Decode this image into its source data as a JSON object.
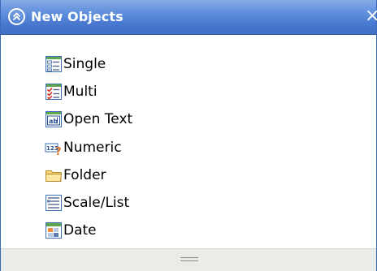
{
  "panel": {
    "title": "New Objects",
    "close_glyph": "×",
    "collapse_icon": "double-chevron-up-icon"
  },
  "items": [
    {
      "label": "Single",
      "icon": "single-choice-icon"
    },
    {
      "label": "Multi",
      "icon": "multi-choice-icon"
    },
    {
      "label": "Open Text",
      "icon": "open-text-icon"
    },
    {
      "label": "Numeric",
      "icon": "numeric-icon"
    },
    {
      "label": "Folder",
      "icon": "folder-icon"
    },
    {
      "label": "Scale/List",
      "icon": "scale-list-icon"
    },
    {
      "label": "Date",
      "icon": "date-icon"
    }
  ],
  "colors": {
    "titlebar": "#4f80d2",
    "border": "#3a69b5",
    "footer": "#ebebe8"
  }
}
